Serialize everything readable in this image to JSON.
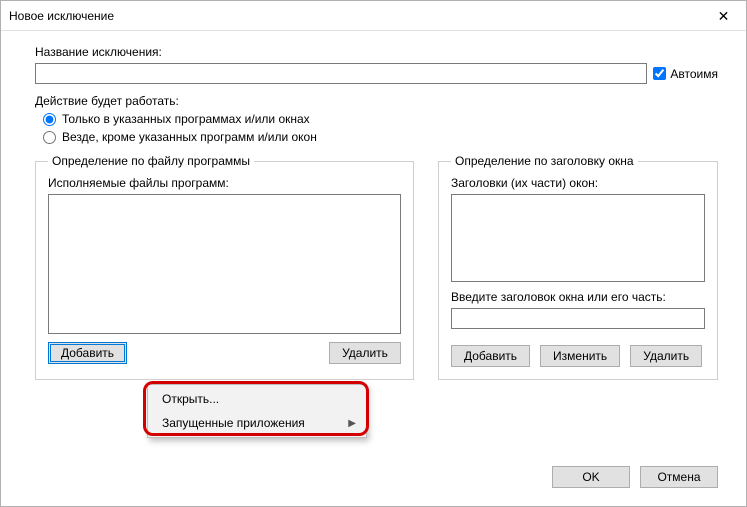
{
  "window": {
    "title": "Новое исключение"
  },
  "name_section": {
    "label": "Название исключения:",
    "value": "",
    "auto_name_label": "Автоимя",
    "auto_name_checked": true
  },
  "scope_section": {
    "label": "Действие будет работать:",
    "option_only": "Только в указанных программах и/или окнах",
    "option_except": "Везде, кроме указанных программ и/или окон",
    "selected": "only"
  },
  "file_group": {
    "legend": "Определение по файлу программы",
    "list_label": "Исполняемые файлы программ:",
    "add_label": "Добавить",
    "delete_label": "Удалить"
  },
  "title_group": {
    "legend": "Определение по заголовку окна",
    "list_label": "Заголовки (их части) окон:",
    "input_label": "Введите заголовок окна или его часть:",
    "input_value": "",
    "add_label": "Добавить",
    "edit_label": "Изменить",
    "delete_label": "Удалить"
  },
  "context_menu": {
    "open": "Открыть...",
    "running": "Запущенные приложения"
  },
  "dialog": {
    "ok": "OK",
    "cancel": "Отмена"
  }
}
